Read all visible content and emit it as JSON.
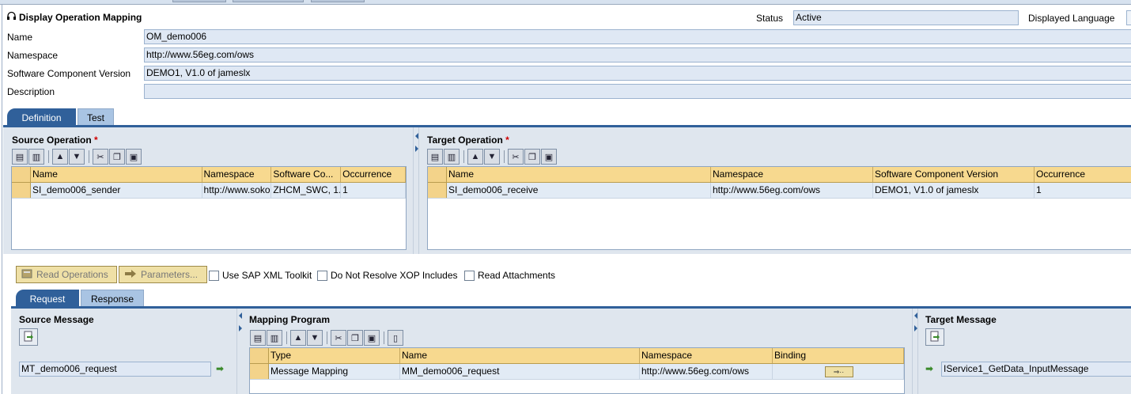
{
  "header": {
    "title": "Display Operation Mapping",
    "status_label": "Status",
    "status_value": "Active",
    "displayed_language_label": "Displayed Language"
  },
  "form": {
    "name_label": "Name",
    "name_value": "OM_demo006",
    "namespace_label": "Namespace",
    "namespace_value": "http://www.56eg.com/ows",
    "swcv_label": "Software Component Version",
    "swcv_value": "DEMO1, V1.0 of jameslx",
    "description_label": "Description",
    "description_value": ""
  },
  "main_tabs": [
    {
      "label": "Definition",
      "active": true
    },
    {
      "label": "Test",
      "active": false
    }
  ],
  "source_operation": {
    "title": "Source Operation",
    "required_marker": "*",
    "columns": [
      "Name",
      "Namespace",
      "Software Co...",
      "Occurrence"
    ],
    "rows": [
      [
        "SI_demo006_sender",
        "http://www.soko",
        "ZHCM_SWC, 1.",
        "1"
      ]
    ]
  },
  "target_operation": {
    "title": "Target Operation",
    "required_marker": "*",
    "columns": [
      "Name",
      "Namespace",
      "Software Component Version",
      "Occurrence"
    ],
    "rows": [
      [
        "SI_demo006_receive",
        "http://www.56eg.com/ows",
        "DEMO1, V1.0 of jameslx",
        "1"
      ]
    ]
  },
  "actions": {
    "read_operations": "Read Operations",
    "parameters": "Parameters...",
    "use_sap_xml_toolkit": "Use SAP XML Toolkit",
    "do_not_resolve_xop": "Do Not Resolve XOP Includes",
    "read_attachments": "Read Attachments"
  },
  "sub_tabs": [
    {
      "label": "Request",
      "active": true
    },
    {
      "label": "Response",
      "active": false
    }
  ],
  "source_message": {
    "title": "Source Message",
    "value": "MT_demo006_request"
  },
  "mapping_program": {
    "title": "Mapping Program",
    "columns": [
      "Type",
      "Name",
      "Namespace",
      "Binding"
    ],
    "rows": [
      [
        "Message Mapping",
        "MM_demo006_request",
        "http://www.56eg.com/ows",
        ""
      ]
    ],
    "binding_button": "⇒··"
  },
  "target_message": {
    "title": "Target Message",
    "value": "IService1_GetData_InputMessage"
  },
  "colors": {
    "tab_active": "#30609a",
    "tab_inactive": "#a9c4e3",
    "grid_header": "#f7d98f",
    "field_bg": "#dfe8f4"
  }
}
